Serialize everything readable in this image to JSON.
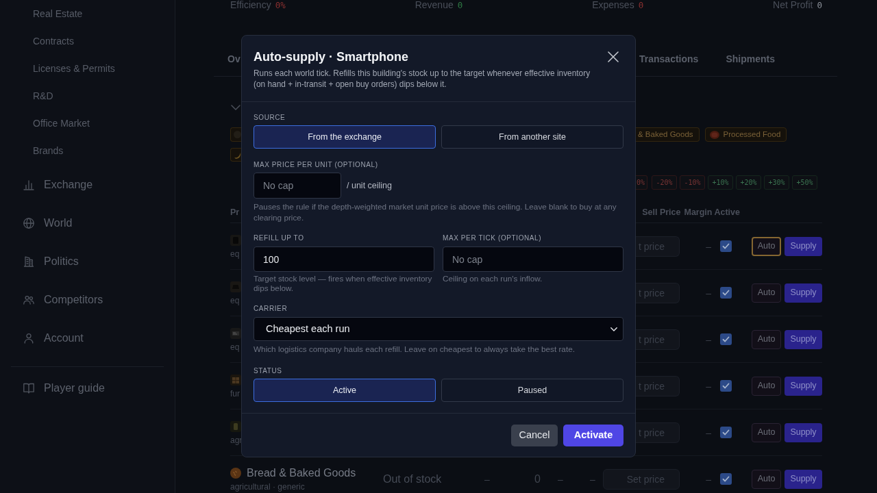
{
  "sidebar": {
    "sub_items": [
      {
        "label": "Real Estate"
      },
      {
        "label": "Contracts"
      },
      {
        "label": "Licenses & Permits"
      },
      {
        "label": "R&D"
      },
      {
        "label": "Office Market"
      },
      {
        "label": "Brands"
      }
    ],
    "items": [
      {
        "label": "Exchange"
      },
      {
        "label": "World"
      },
      {
        "label": "Politics"
      },
      {
        "label": "Competitors"
      },
      {
        "label": "Account"
      }
    ],
    "footer_item": {
      "label": "Player guide"
    }
  },
  "stats": [
    {
      "label": "Efficiency",
      "value": "0%",
      "color": "#8a3030"
    },
    {
      "label": "Revenue",
      "value": "0",
      "color": "#2f7a45"
    },
    {
      "label": "Expenses",
      "value": "0",
      "color": "#8a3030"
    },
    {
      "label": "Net Profit",
      "value": "0",
      "color": "#8b9099"
    }
  ],
  "tabs": [
    {
      "label": "Ov"
    },
    {
      "label": "Transactions"
    },
    {
      "label": "Shipments"
    }
  ],
  "category_chips": [
    {
      "label": "& Baked Goods",
      "clipped": true
    },
    {
      "label": "Processed Food",
      "clipped": false
    }
  ],
  "price_steps": [
    {
      "label": "0%",
      "kind": "down",
      "clipped": true
    },
    {
      "label": "-20%",
      "kind": "down",
      "clipped": false
    },
    {
      "label": "-10%",
      "kind": "down",
      "clipped": false
    },
    {
      "label": "+10%",
      "kind": "up",
      "clipped": false
    },
    {
      "label": "+20%",
      "kind": "up",
      "clipped": false
    },
    {
      "label": "+30%",
      "kind": "up",
      "clipped": false
    },
    {
      "label": "+50%",
      "kind": "up",
      "clipped": false
    }
  ],
  "table": {
    "columns": [
      "Pr",
      "Sell Price",
      "Margin",
      "Active"
    ],
    "rows": [
      {
        "kind": "clipped",
        "category": "eq",
        "price_placeholder": "t price",
        "margin": "–",
        "active": true,
        "focused": true,
        "auto": "Auto",
        "supply": "Supply"
      },
      {
        "kind": "clipped",
        "category": "eq",
        "price_placeholder": "t price",
        "margin": "–",
        "active": true,
        "focused": false,
        "auto": "Auto",
        "supply": "Supply"
      },
      {
        "kind": "clipped",
        "category": "eq",
        "price_placeholder": "t price",
        "margin": "–",
        "active": true,
        "focused": false,
        "auto": "Auto",
        "supply": "Supply"
      },
      {
        "kind": "clipped",
        "category": "fur",
        "price_placeholder": "t price",
        "margin": "–",
        "active": true,
        "focused": false,
        "auto": "Auto",
        "supply": "Supply"
      },
      {
        "kind": "clipped",
        "category": "agr",
        "price_placeholder": "t price",
        "margin": "–",
        "active": true,
        "focused": false,
        "auto": "Auto",
        "supply": "Supply"
      },
      {
        "kind": "full",
        "name": "Bread & Baked Goods",
        "category": "agricultural · generic",
        "stock": "Out of stock",
        "cells": [
          "–",
          "0",
          "–",
          "–"
        ],
        "price_placeholder": "Set price",
        "margin": "–",
        "active": true,
        "focused": false,
        "auto": "Auto",
        "supply": "Supply"
      }
    ]
  },
  "dialog": {
    "title": "Auto-supply · Smartphone",
    "description": "Runs each world tick. Refills this building's stock up to the target whenever effective inventory (on hand + in-transit + open buy orders) dips below it.",
    "source": {
      "label": "SOURCE",
      "options": [
        {
          "label": "From the exchange",
          "selected": true
        },
        {
          "label": "From another site",
          "selected": false
        }
      ]
    },
    "max_price": {
      "label": "MAX PRICE PER UNIT (OPTIONAL)",
      "placeholder": "No cap",
      "suffix": "/ unit ceiling",
      "help": "Pauses the rule if the depth-weighted market unit price is above this ceiling. Leave blank to buy at any clearing price."
    },
    "refill": {
      "label": "REFILL UP TO",
      "value": "100",
      "help": "Target stock level — fires when effective inventory dips below."
    },
    "max_per_tick": {
      "label": "MAX PER TICK (OPTIONAL)",
      "placeholder": "No cap",
      "help": "Ceiling on each run's inflow."
    },
    "carrier": {
      "label": "CARRIER",
      "value": "Cheapest each run",
      "help": "Which logistics company hauls each refill. Leave on cheapest to always take the best rate."
    },
    "status": {
      "label": "STATUS",
      "options": [
        {
          "label": "Active",
          "selected": true
        },
        {
          "label": "Paused",
          "selected": false
        }
      ]
    },
    "buttons": [
      {
        "label": "Cancel",
        "kind": "secondary"
      },
      {
        "label": "Activate",
        "kind": "primary"
      }
    ]
  }
}
